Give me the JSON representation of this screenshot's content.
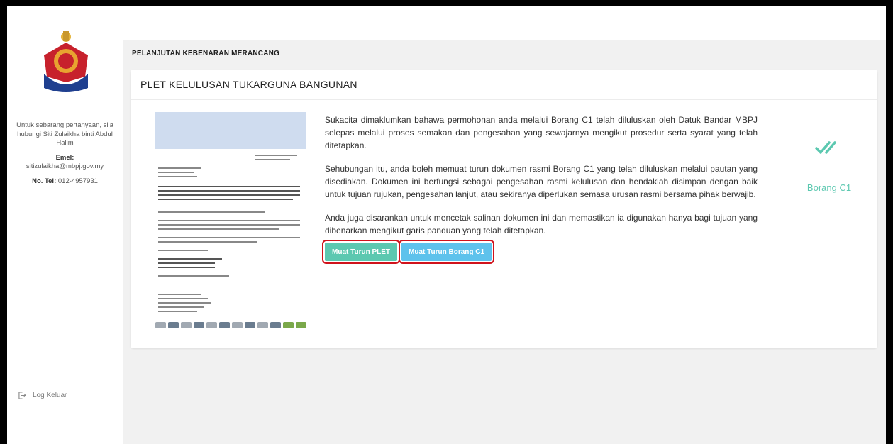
{
  "sidebar": {
    "contact_line": "Untuk sebarang pertanyaan, sila hubungi Siti Zulaikha binti Abdul Halim",
    "email_label": "Emel:",
    "email_value": "sitizulaikha@mbpj.gov.my",
    "phone_label": "No. Tel:",
    "phone_value": "012-4957931",
    "logout_label": "Log Keluar",
    "logo_text": "MBPJ"
  },
  "page": {
    "title": "PELANJUTAN KEBENARAN MERANCANG"
  },
  "card": {
    "title": "PLET KELULUSAN TUKARGUNA BANGUNAN",
    "paragraphs": [
      "Sukacita dimaklumkan bahawa permohonan anda melalui Borang C1 telah diluluskan oleh Datuk Bandar MBPJ selepas melalui proses semakan dan pengesahan yang sewajarnya mengikut prosedur serta syarat yang telah ditetapkan.",
      "Sehubungan itu, anda boleh memuat turun dokumen rasmi Borang C1 yang telah diluluskan melalui pautan yang disediakan. Dokumen ini berfungsi sebagai pengesahan rasmi kelulusan dan hendaklah disimpan dengan baik untuk tujuan rujukan, pengesahan lanjut, atau sekiranya diperlukan semasa urusan rasmi bersama pihak berwajib.",
      "Anda juga disarankan untuk mencetak salinan dokumen ini dan memastikan ia digunakan hanya bagi tujuan yang dibenarkan mengikut garis panduan yang telah ditetapkan."
    ],
    "buttons": {
      "download_plet": "Muat Turun PLET",
      "download_c1": "Muat Turun Borang C1"
    },
    "status": {
      "label": "Borang C1",
      "icon": "double-check-icon"
    }
  },
  "colors": {
    "accent_green": "#5cc8b0",
    "accent_blue": "#5ec2ec",
    "highlight_red": "#d0121b"
  }
}
